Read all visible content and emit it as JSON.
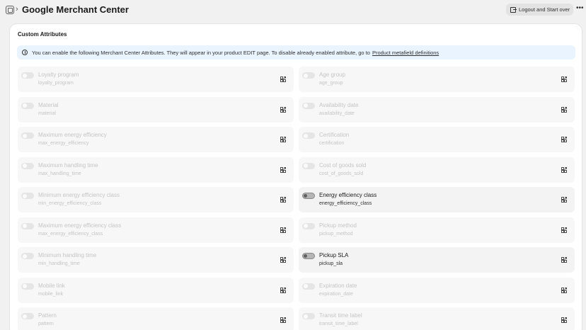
{
  "header": {
    "title": "Google Merchant Center",
    "logout_label": "Logout and Start over",
    "more_label": "•••"
  },
  "card": {
    "title": "Custom Attributes",
    "banner_text": "You can enable the following Merchant Center Attributes. They will appear in your product EDIT page. To disable already enabled attribute, go to",
    "banner_link": "Product metafield definitions"
  },
  "attributes": [
    {
      "label": "Loyalty program",
      "key": "loyalty_program",
      "enabled": false
    },
    {
      "label": "Age group",
      "key": "age_group",
      "enabled": false
    },
    {
      "label": "Material",
      "key": "material",
      "enabled": false
    },
    {
      "label": "Availability date",
      "key": "availability_date",
      "enabled": false
    },
    {
      "label": "Maximum energy efficiency",
      "key": "max_energy_efficiency",
      "enabled": false
    },
    {
      "label": "Certification",
      "key": "certification",
      "enabled": false
    },
    {
      "label": "Maximum handling time",
      "key": "max_handling_time",
      "enabled": false
    },
    {
      "label": "Cost of goods sold",
      "key": "cost_of_goods_sold",
      "enabled": false
    },
    {
      "label": "Minimum energy efficiency class",
      "key": "min_energy_efficiency_class",
      "enabled": false
    },
    {
      "label": "Energy efficiency class",
      "key": "energy_efficiency_class",
      "enabled": true
    },
    {
      "label": "Maximum energy efficiency class",
      "key": "max_energy_efficiency_class",
      "enabled": false
    },
    {
      "label": "Pickup method",
      "key": "pickup_method",
      "enabled": false
    },
    {
      "label": "Minimum handling time",
      "key": "min_handling_time",
      "enabled": false
    },
    {
      "label": "Pickup SLA",
      "key": "pickup_sla",
      "enabled": true
    },
    {
      "label": "Mobile link",
      "key": "mobile_link",
      "enabled": false
    },
    {
      "label": "Expiration date",
      "key": "expiration_date",
      "enabled": false
    },
    {
      "label": "Pattern",
      "key": "pattern",
      "enabled": false
    },
    {
      "label": "Transit time label",
      "key": "transit_time_label",
      "enabled": false
    }
  ]
}
